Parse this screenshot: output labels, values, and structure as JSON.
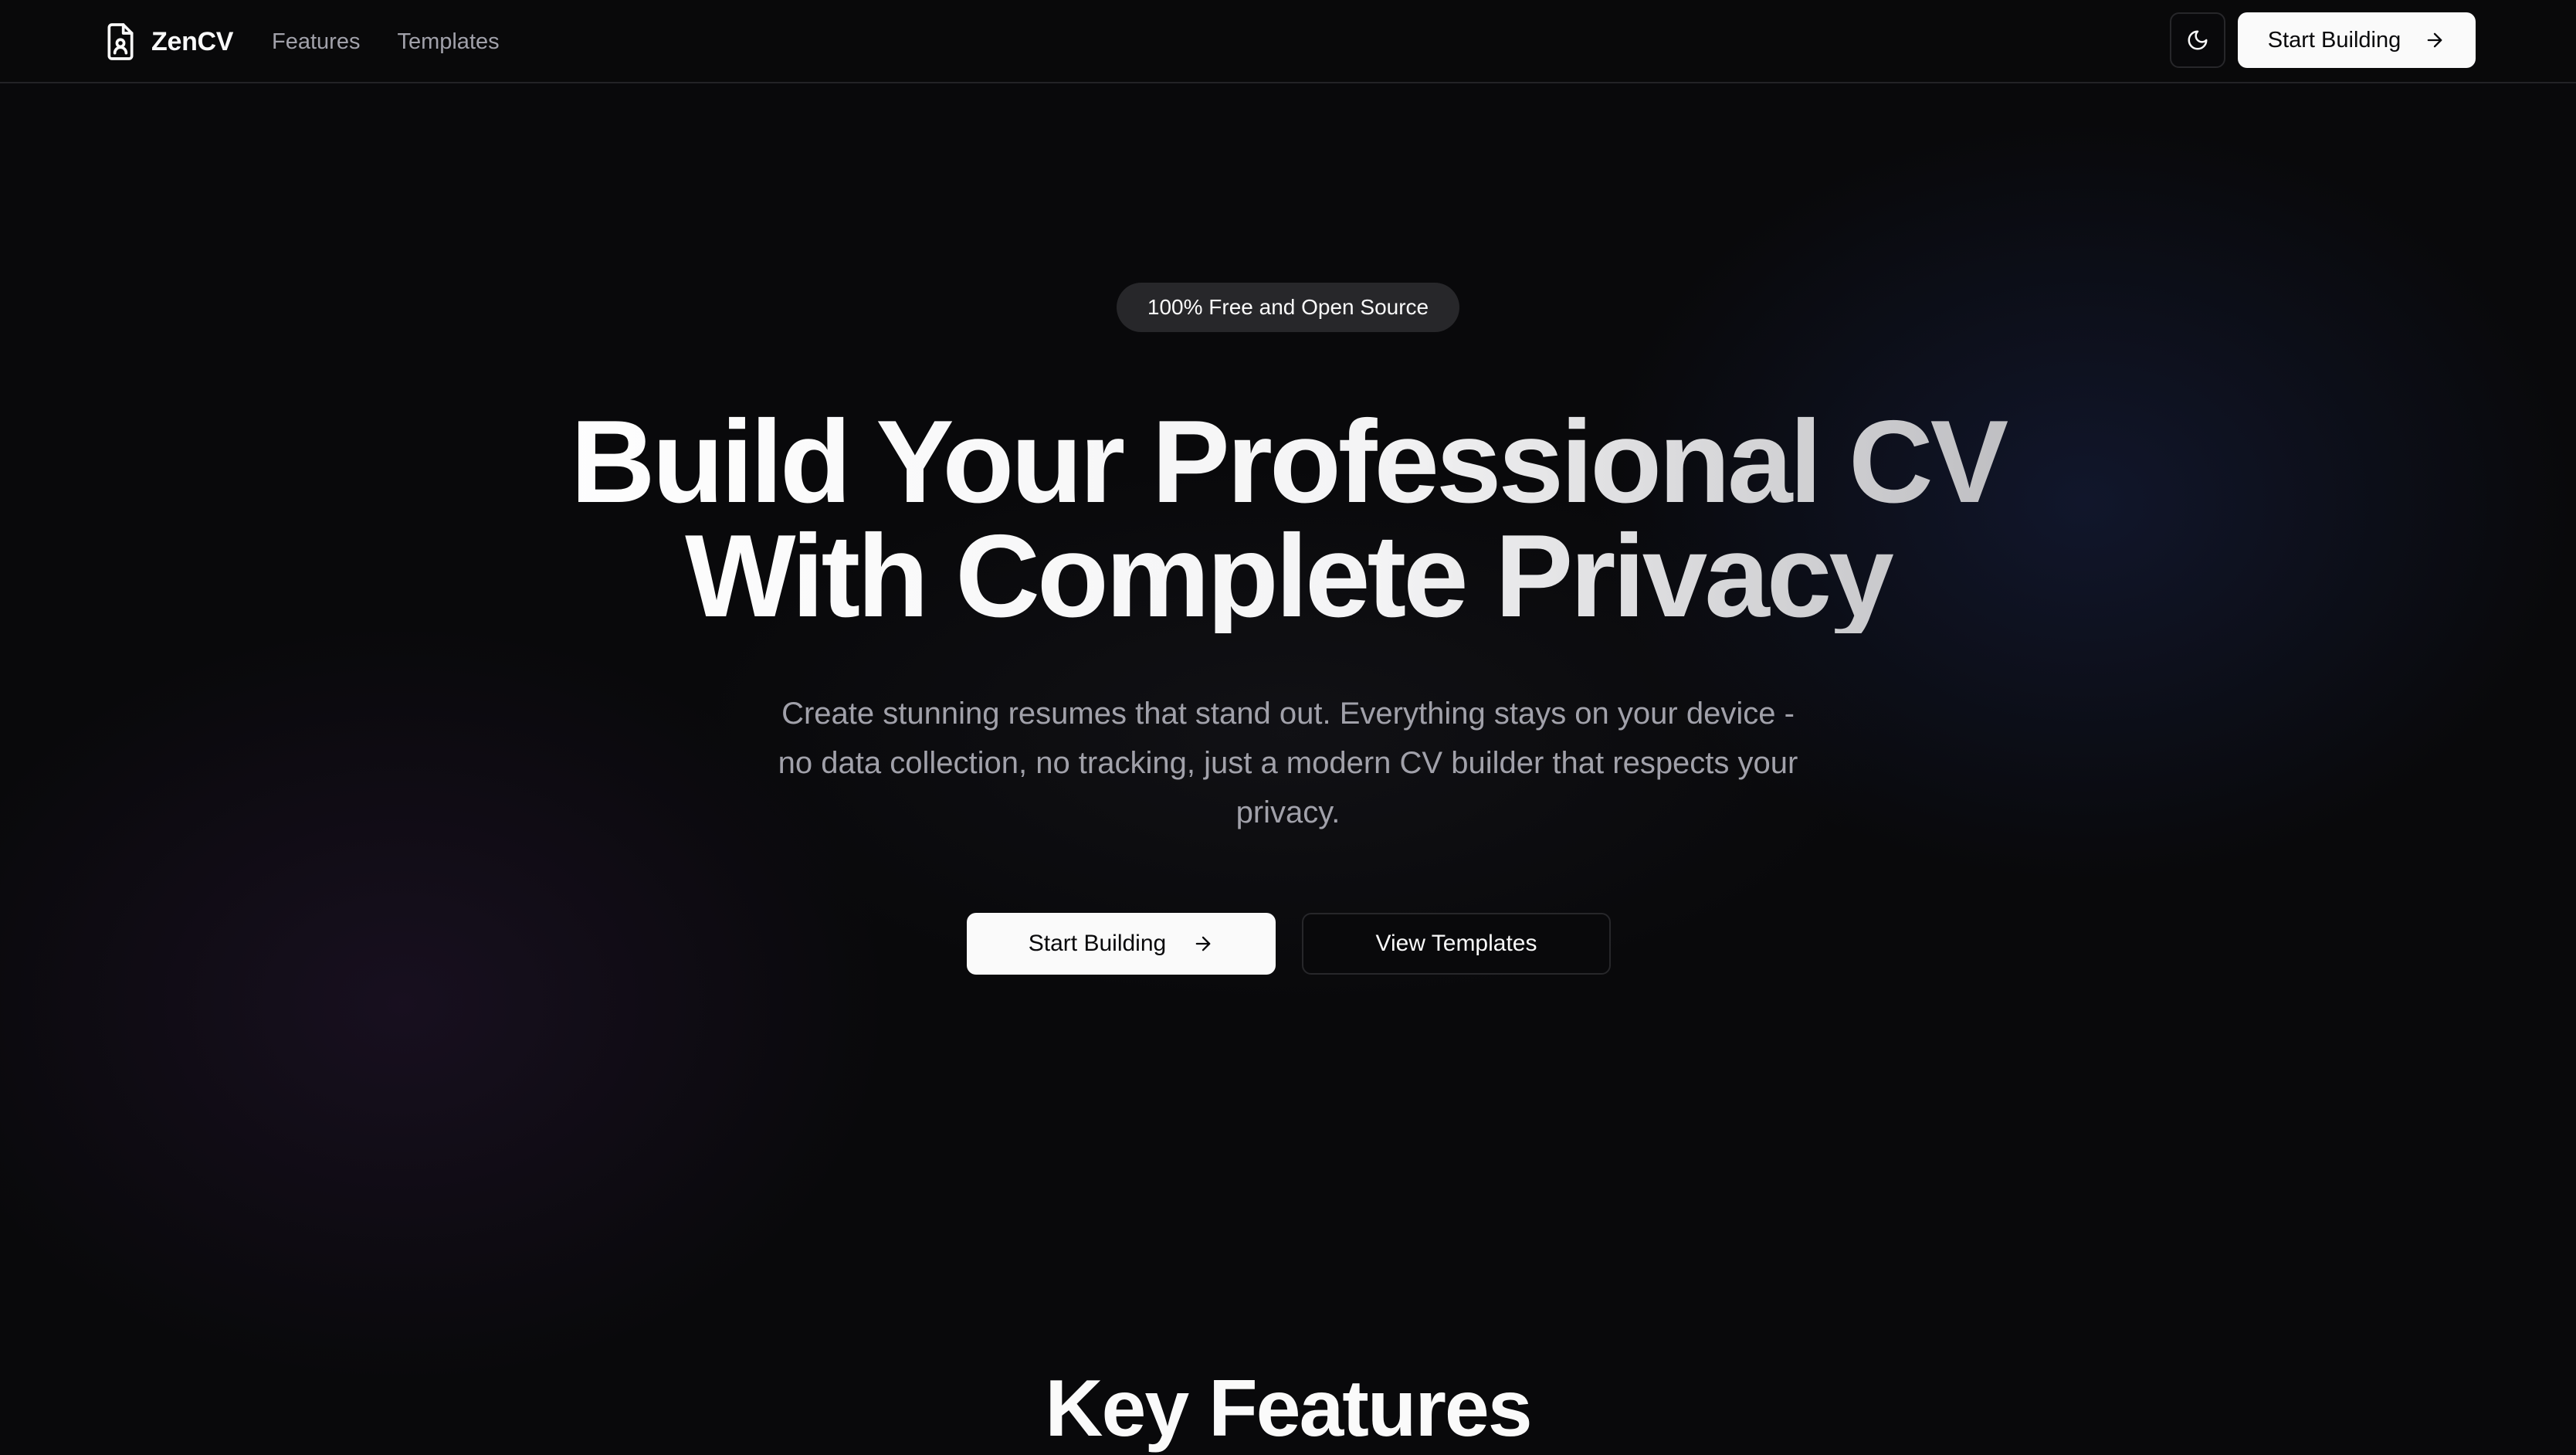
{
  "nav": {
    "brand": "ZenCV",
    "brand_icon": "file-user-icon",
    "links": [
      {
        "label": "Features"
      },
      {
        "label": "Templates"
      }
    ],
    "theme_toggle_icon": "moon-icon",
    "cta_label": "Start Building",
    "cta_icon": "arrow-right-icon"
  },
  "hero": {
    "badge": "100% Free and Open Source",
    "title_line1": "Build Your Professional CV",
    "title_line2": "With Complete Privacy",
    "subtitle": "Create stunning resumes that stand out. Everything stays on your device - no data collection, no tracking, just a modern CV builder that respects your privacy.",
    "primary_button": "Start Building",
    "primary_icon": "arrow-right-icon",
    "secondary_button": "View Templates"
  },
  "features": {
    "heading": "Key Features"
  },
  "colors": {
    "background": "#09090b",
    "foreground": "#fafafa",
    "muted": "#a1a1aa",
    "border": "#27272a",
    "badge_bg": "#27272a"
  }
}
